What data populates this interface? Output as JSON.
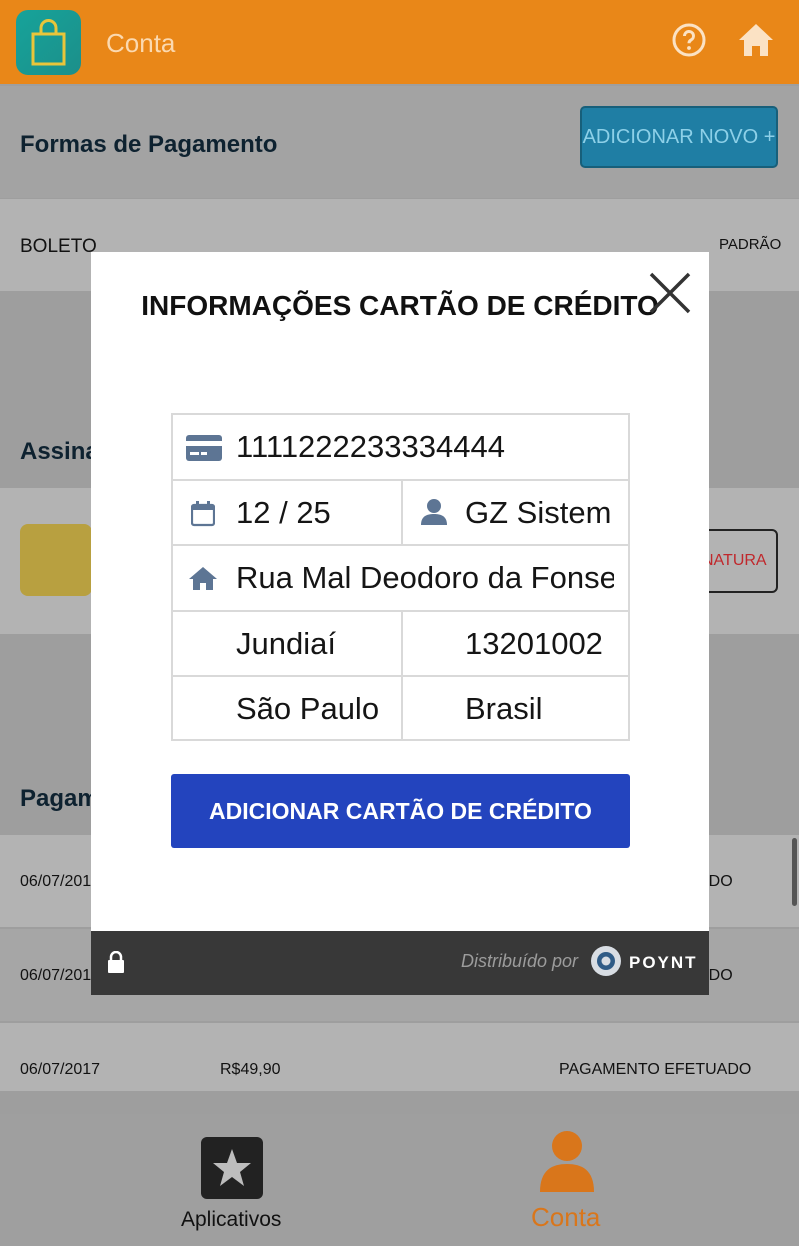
{
  "header": {
    "title": "Conta"
  },
  "payment_methods": {
    "title": "Formas de Pagamento",
    "add_new_label": "ADICIONAR NOVO +",
    "items": [
      {
        "name": "BOLETO",
        "tag": "PADRÃO"
      }
    ]
  },
  "subscriptions": {
    "title_visible": "Assina",
    "button_visible": "NATURA"
  },
  "payments": {
    "title_visible": "Pagam",
    "rows": [
      {
        "date": "06/07/201",
        "status": "ADO"
      },
      {
        "date": "06/07/201",
        "status": "ADO"
      },
      {
        "date": "06/07/2017",
        "amount": "R$49,90",
        "status": "PAGAMENTO EFETUADO"
      }
    ]
  },
  "modal": {
    "title": "INFORMAÇÕES CARTÃO DE CRÉDITO",
    "card_number": "1111222233334444",
    "expiry": "12 / 25",
    "holder": "GZ Sistem",
    "address": "Rua Mal Deodoro da Fonse",
    "city": "Jundiaí",
    "zip": "13201002",
    "state": "São Paulo",
    "country": "Brasil",
    "submit_label": "ADICIONAR CARTÃO DE CRÉDITO",
    "footer": {
      "distributed_by": "Distribuído por",
      "brand": "POYNT"
    }
  },
  "bottom_nav": {
    "items": [
      {
        "label": "Aplicativos",
        "icon": "star-icon"
      },
      {
        "label": "Conta",
        "icon": "person-icon",
        "active": true
      }
    ]
  },
  "colors": {
    "accent": "#e98718",
    "primary_button": "#2344be",
    "footer": "#383838"
  }
}
